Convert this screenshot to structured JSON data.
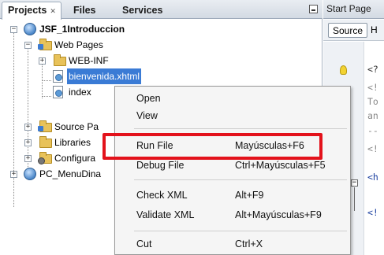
{
  "projects_panel": {
    "tabs": [
      {
        "label": "Projects",
        "close": "✕"
      },
      {
        "label": "Files"
      },
      {
        "label": "Services"
      }
    ],
    "minimize_icon": "minimize-icon",
    "tree": [
      {
        "label": "JSF_1Introduccion",
        "icon": "globe-icon",
        "toggle": "−",
        "bold": true
      },
      {
        "label": "Web Pages",
        "icon": "folder-icon",
        "toggle": "−"
      },
      {
        "label": "WEB-INF",
        "icon": "folder-icon",
        "toggle": "+"
      },
      {
        "label": "bienvenida.xhtml",
        "icon": "file-icon",
        "selected": true
      },
      {
        "label": "index",
        "icon": "file-icon"
      },
      {
        "label": "Source Pa",
        "icon": "folder-icon",
        "toggle": "+"
      },
      {
        "label": "Libraries",
        "icon": "folder-icon",
        "toggle": "+"
      },
      {
        "label": "Configura",
        "icon": "folder-icon",
        "toggle": "+"
      },
      {
        "label": "PC_MenuDina",
        "icon": "globe-icon",
        "toggle": "+"
      }
    ]
  },
  "editor_panel": {
    "tab_label": "Start Page",
    "source_button": "Source",
    "history_button": "H",
    "code_lines": [
      "<?",
      "<!",
      "To",
      "an",
      "--",
      "<!",
      "<h",
      "<!"
    ]
  },
  "context_menu": {
    "items": [
      {
        "label": "Open",
        "shortcut": ""
      },
      {
        "label": "View",
        "shortcut": ""
      },
      {
        "label": "Run File",
        "shortcut": "Mayúsculas+F6"
      },
      {
        "label": "Debug File",
        "shortcut": "Ctrl+Mayúsculas+F5"
      },
      {
        "label": "Check XML",
        "shortcut": "Alt+F9"
      },
      {
        "label": "Validate XML",
        "shortcut": "Alt+Mayúsculas+F9"
      },
      {
        "label": "Cut",
        "shortcut": "Ctrl+X"
      }
    ],
    "highlight_color": "#e3121b",
    "highlighted_item": "Run File"
  }
}
